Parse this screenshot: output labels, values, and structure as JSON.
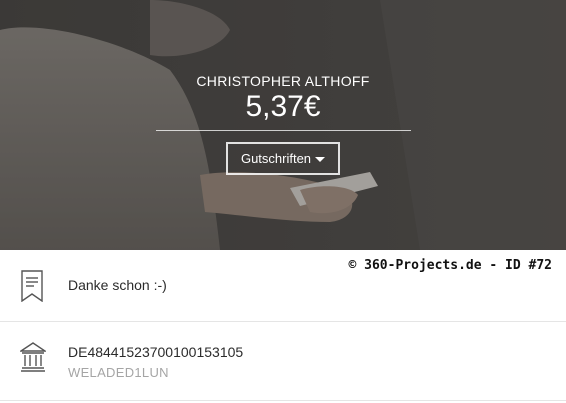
{
  "account": {
    "holder_name": "CHRISTOPHER ALTHOFF",
    "balance": "5,37€"
  },
  "filter": {
    "selected": "Gutschriften",
    "icon": "chevron-down-icon"
  },
  "watermark": "© 360-Projects.de - ID #72",
  "details": {
    "reference": {
      "icon": "document-bookmark-icon",
      "text": "Danke schon :-)"
    },
    "bank": {
      "icon": "bank-building-icon",
      "iban": "DE48441523700100153105",
      "bic": "WELADED1LUN"
    }
  },
  "colors": {
    "text_primary": "#2b2b2b",
    "text_secondary": "#a5a5a5",
    "hero_text": "#ffffff",
    "divider": "#e5e5e5"
  }
}
